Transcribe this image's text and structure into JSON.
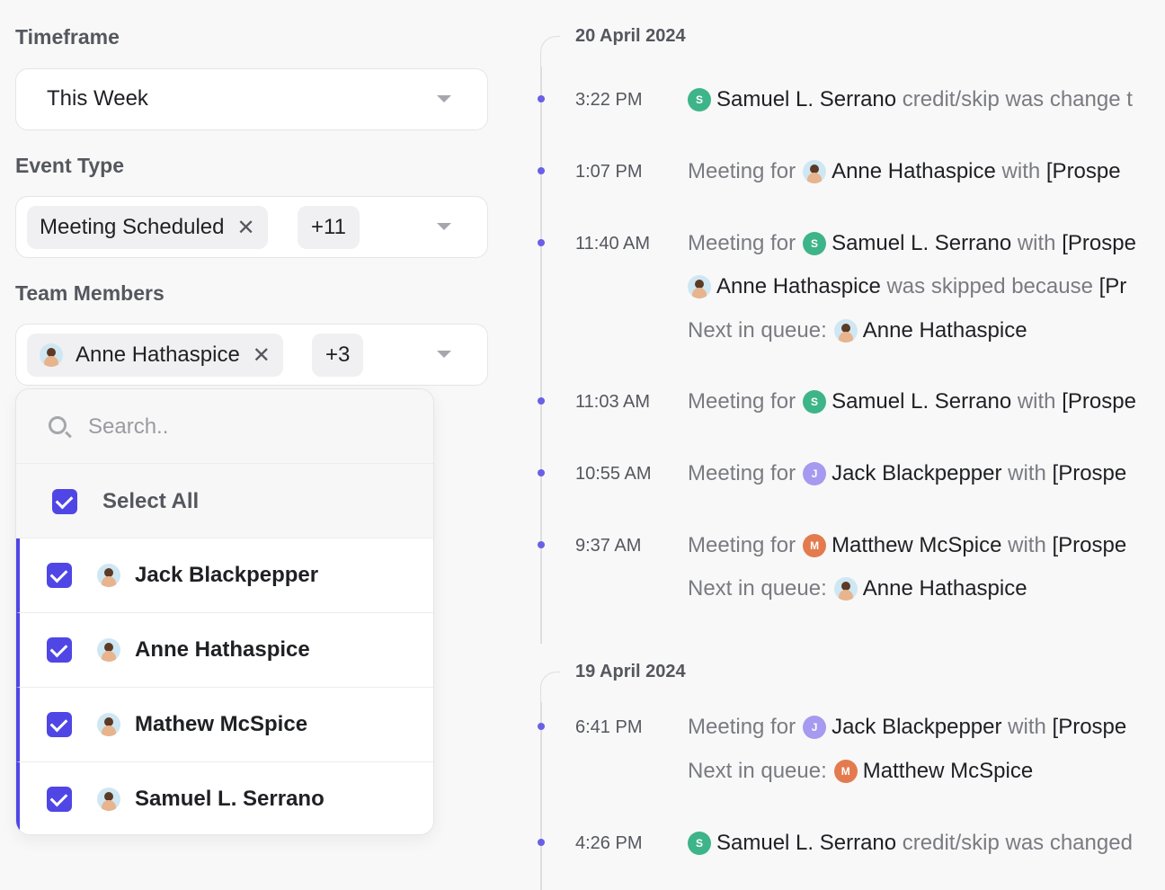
{
  "filters": {
    "timeframe": {
      "label": "Timeframe",
      "value": "This Week"
    },
    "event_type": {
      "label": "Event Type",
      "chip": "Meeting Scheduled",
      "more": "+11"
    },
    "team_members": {
      "label": "Team Members",
      "chip": "Anne Hathaspice",
      "more": "+3"
    },
    "remove_glyph": "✕"
  },
  "dropdown": {
    "search_placeholder": "Search..",
    "select_all": "Select All",
    "options": [
      {
        "name": "Jack Blackpepper",
        "checked": true
      },
      {
        "name": "Anne Hathaspice",
        "checked": true
      },
      {
        "name": "Mathew McSpice",
        "checked": true
      },
      {
        "name": "Samuel L. Serrano",
        "checked": true
      }
    ]
  },
  "timeline": {
    "groups": [
      {
        "date": "20 April 2024",
        "events": [
          {
            "time": "3:22 PM",
            "lines": [
              {
                "person": "Samuel L. Serrano",
                "avatar": "S",
                "tail": "credit/skip was change t"
              }
            ]
          },
          {
            "time": "1:07 PM",
            "lines": [
              {
                "prefix": "Meeting for",
                "person": "Anne Hathaspice",
                "avatar": "photo",
                "with": "with",
                "tail": "[Prospe"
              }
            ]
          },
          {
            "time": "11:40 AM",
            "lines": [
              {
                "prefix": "Meeting for",
                "person": "Samuel L. Serrano",
                "avatar": "S",
                "with": "with",
                "tail": "[Prospe"
              },
              {
                "person": "Anne Hathaspice",
                "avatar": "photo",
                "mid": "was skipped because",
                "tail": "[Pr"
              },
              {
                "prefix": "Next in queue:",
                "person": "Anne Hathaspice",
                "avatar": "photo"
              }
            ]
          },
          {
            "time": "11:03 AM",
            "lines": [
              {
                "prefix": "Meeting for",
                "person": "Samuel L. Serrano",
                "avatar": "S",
                "with": "with",
                "tail": "[Prospe"
              }
            ]
          },
          {
            "time": "10:55 AM",
            "lines": [
              {
                "prefix": "Meeting for",
                "person": "Jack Blackpepper",
                "avatar": "J",
                "with": "with",
                "tail": "[Prospe"
              }
            ]
          },
          {
            "time": "9:37 AM",
            "lines": [
              {
                "prefix": "Meeting for",
                "person": "Matthew McSpice",
                "avatar": "M",
                "with": "with",
                "tail": "[Prospe"
              },
              {
                "prefix": "Next in queue:",
                "person": "Anne Hathaspice",
                "avatar": "photo"
              }
            ]
          }
        ]
      },
      {
        "date": "19 April 2024",
        "events": [
          {
            "time": "6:41 PM",
            "lines": [
              {
                "prefix": "Meeting for",
                "person": "Jack Blackpepper",
                "avatar": "J",
                "with": "with",
                "tail": "[Prospe"
              },
              {
                "prefix": "Next in queue:",
                "person": "Matthew McSpice",
                "avatar": "M"
              }
            ]
          },
          {
            "time": "4:26 PM",
            "lines": [
              {
                "person": "Samuel L. Serrano",
                "avatar": "S",
                "tail": "credit/skip was changed"
              }
            ]
          }
        ]
      }
    ]
  },
  "colors": {
    "accent": "#4f46e5",
    "dot": "#6a60e6",
    "s_avatar": "#3eb489",
    "j_avatar": "#a59af0",
    "m_avatar": "#e37b4e"
  }
}
